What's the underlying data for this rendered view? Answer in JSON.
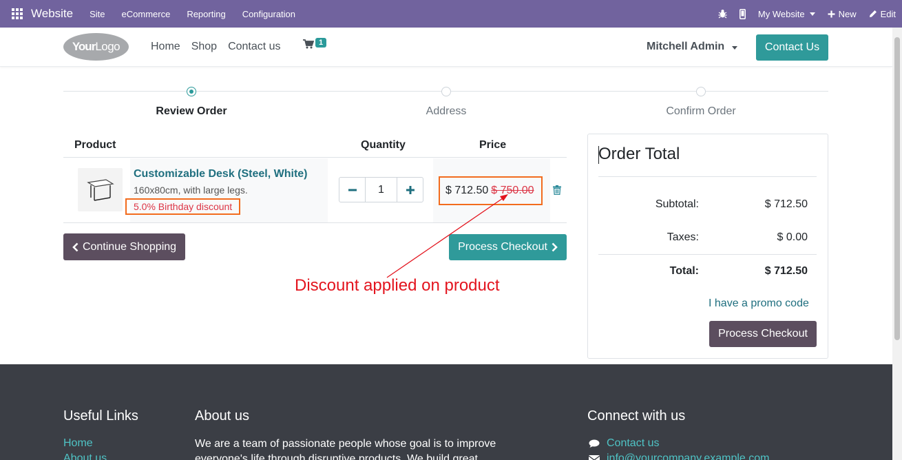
{
  "topbar": {
    "app_name": "Website",
    "menus": [
      "Site",
      "eCommerce",
      "Reporting",
      "Configuration"
    ],
    "website_selector": "My Website",
    "new_label": "New",
    "edit_label": "Edit"
  },
  "header": {
    "logo": {
      "your": "Your",
      "logo": "Logo"
    },
    "nav": [
      "Home",
      "Shop",
      "Contact us"
    ],
    "cart_count": "1",
    "user": "Mitchell Admin",
    "contact_button": "Contact Us"
  },
  "wizard": {
    "steps": [
      "Review Order",
      "Address",
      "Confirm Order"
    ],
    "active_step": "Review Order"
  },
  "cart": {
    "headers": {
      "product": "Product",
      "quantity": "Quantity",
      "price": "Price"
    },
    "item": {
      "name": "Customizable Desk (Steel, White)",
      "description": "160x80cm, with large legs.",
      "discount": "5.0% Birthday discount",
      "quantity": "1",
      "price": "$ 712.50",
      "old_price": "$ 750.00"
    },
    "continue_label": "Continue Shopping",
    "checkout_label": "Process Checkout"
  },
  "annotation": "Discount applied on product",
  "order_total": {
    "title": "Order Total",
    "subtotal_label": "Subtotal:",
    "subtotal_value": "$ 712.50",
    "taxes_label": "Taxes:",
    "taxes_value": "$ 0.00",
    "total_label": "Total:",
    "total_value": "$ 712.50",
    "promo_link": "I have a promo code",
    "checkout_label": "Process Checkout"
  },
  "footer": {
    "useful_links_title": "Useful Links",
    "links": [
      "Home",
      "About us"
    ],
    "about_title": "About us",
    "about_text": "We are a team of passionate people whose goal is to improve everyone's life through disruptive products. We build great",
    "connect_title": "Connect with us",
    "contact_link": "Contact us",
    "email_link": "info@yourcompany.example.com"
  },
  "colors": {
    "topbar": "#71639e",
    "accent": "#2f9a9a",
    "secondary_button": "#5c4e5f",
    "annotation": "#e3141e",
    "highlight_box": "#f26b1d",
    "footer": "#3b3e45"
  }
}
